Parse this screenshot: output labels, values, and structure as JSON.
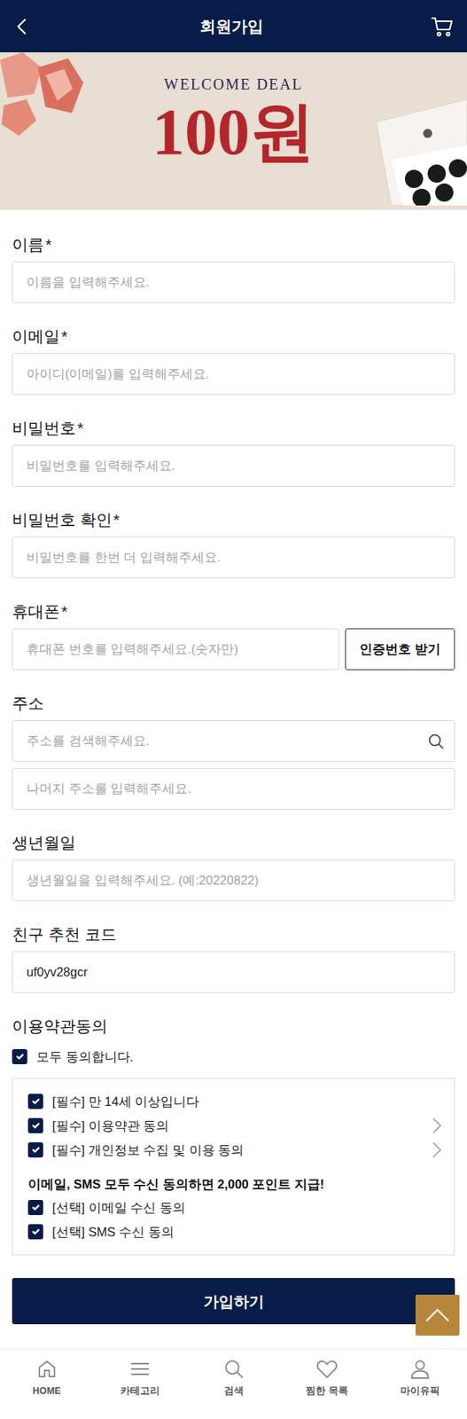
{
  "header": {
    "title": "회원가입"
  },
  "banner": {
    "eyebrow": "WELCOME DEAL",
    "price": "100원"
  },
  "form": {
    "required_mark": "*",
    "fields": [
      {
        "kind": "text",
        "label": "이름",
        "required": true,
        "placeholder": "이름을 입력해주세요."
      },
      {
        "kind": "email",
        "label": "이메일",
        "required": true,
        "placeholder": "아이디(이메일)를 입력해주세요."
      },
      {
        "kind": "password",
        "label": "비밀번호",
        "required": true,
        "placeholder": "비밀번호를 입력해주세요."
      },
      {
        "kind": "password",
        "label": "비밀번호 확인",
        "required": true,
        "placeholder": "비밀번호를 한번 더 입력해주세요."
      },
      {
        "kind": "phone",
        "label": "휴대폰",
        "required": true,
        "placeholder": "휴대폰 번호를 입력해주세요.(숫자만)",
        "button": "인증번호 받기"
      },
      {
        "kind": "address",
        "label": "주소",
        "required": false,
        "placeholder": "주소를 검색해주세요.",
        "detail_placeholder": "나머지 주소를 입력해주세요."
      },
      {
        "kind": "text",
        "label": "생년월일",
        "required": false,
        "placeholder": "생년월일을 입력해주세요. (예:20220822)"
      },
      {
        "kind": "code",
        "label": "친구 추천 코드",
        "required": false,
        "value": "uf0yv28gcr"
      }
    ]
  },
  "terms": {
    "title": "이용약관동의",
    "all": {
      "label": "모두 동의합니다.",
      "checked": true
    },
    "items": [
      {
        "kind": "check",
        "label": "[필수] 만 14세 이상입니다",
        "checked": true,
        "has_detail": false
      },
      {
        "kind": "check",
        "label": "[필수] 이용약관 동의",
        "checked": true,
        "has_detail": true
      },
      {
        "kind": "check",
        "label": "[필수] 개인정보 수집 및 이용 동의",
        "checked": true,
        "has_detail": true
      },
      {
        "kind": "note",
        "label": "이메일, SMS 모두 수신 동의하면 2,000 포인트 지급!"
      },
      {
        "kind": "check",
        "label": "[선택] 이메일 수신 동의",
        "checked": true,
        "has_detail": false
      },
      {
        "kind": "check",
        "label": "[선택] SMS 수신 동의",
        "checked": true,
        "has_detail": false
      }
    ]
  },
  "submit": "가입하기",
  "bottom_nav": [
    {
      "label": "HOME"
    },
    {
      "label": "카테고리"
    },
    {
      "label": "검색"
    },
    {
      "label": "찜한 목록"
    },
    {
      "label": "마이유픽"
    }
  ]
}
